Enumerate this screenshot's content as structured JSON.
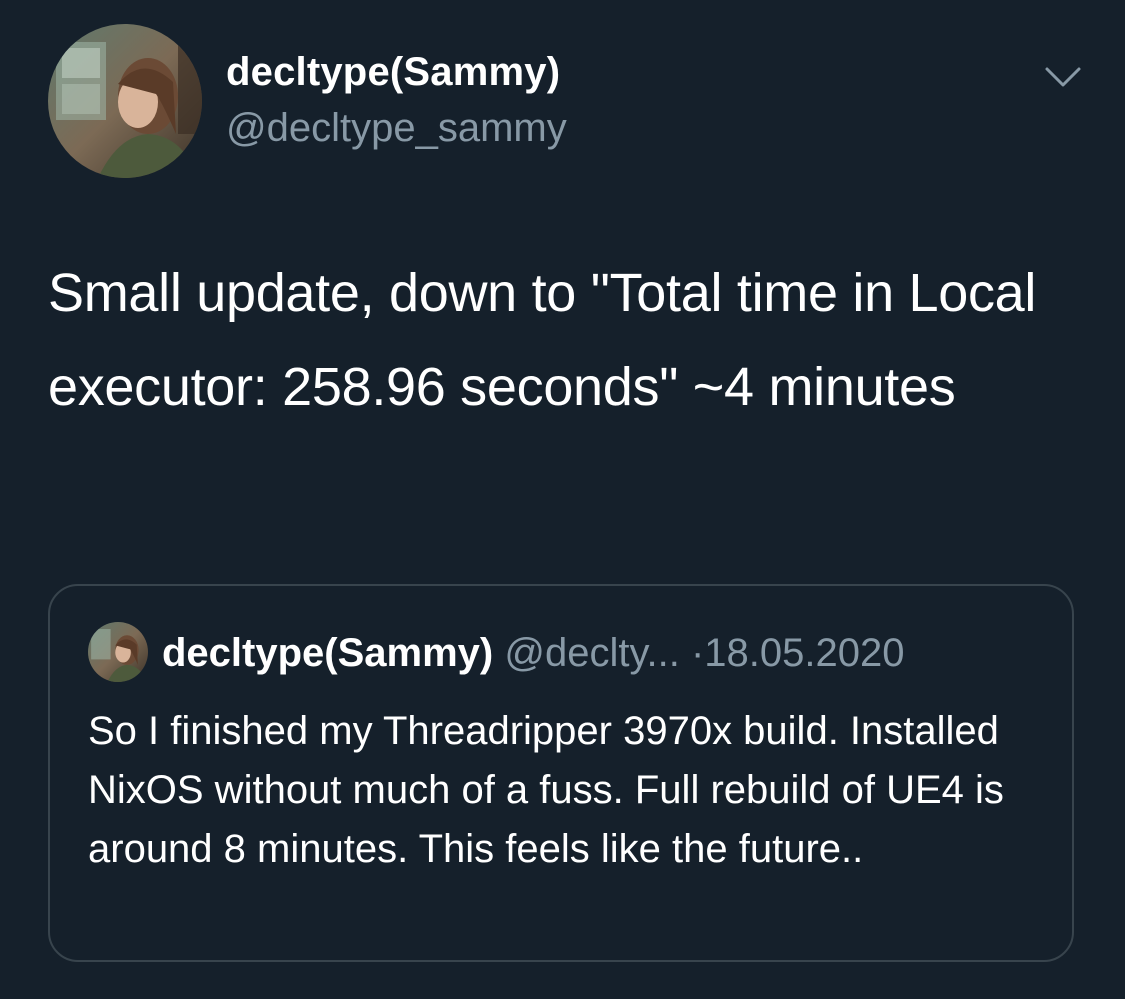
{
  "tweet": {
    "author_name": "decltype(Sammy)",
    "author_handle": "@decltype_sammy",
    "text": "Small update, down to \"Total time in Local executor: 258.96 seconds\" ~4 minutes",
    "menu_icon": "chevron-down-icon"
  },
  "quoted_tweet": {
    "author_name": "decltype(Sammy)",
    "author_handle": "@declty...",
    "separator": "·",
    "date": "18.05.2020",
    "text": "So I finished my Threadripper 3970x build. Installed NixOS without much of a fuss. Full rebuild of UE4 is around 8 minutes. This feels like the future.."
  },
  "colors": {
    "background": "#15202b",
    "primary_text": "#ffffff",
    "secondary_text": "#8899a6",
    "border": "#38444d"
  }
}
